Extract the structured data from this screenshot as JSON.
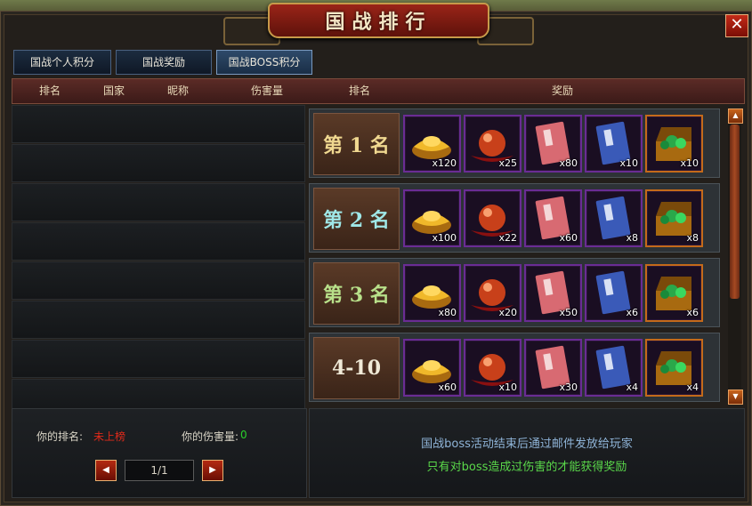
{
  "window": {
    "title": "国战排行",
    "close_label": "✕"
  },
  "tabs": [
    {
      "label": "国战个人积分"
    },
    {
      "label": "国战奖励"
    },
    {
      "label": "国战BOSS积分"
    }
  ],
  "active_tab": 2,
  "columns": {
    "rank": "排名",
    "country": "国家",
    "nickname": "昵称",
    "damage": "伤害量",
    "reward_rank": "排名",
    "reward": "奖励"
  },
  "rewards": [
    {
      "rank": "第 1 名",
      "rank_color": "#f0d890",
      "counts": [
        "x120",
        "x25",
        "x80",
        "x10",
        "x10"
      ]
    },
    {
      "rank": "第 2 名",
      "rank_color": "#9fe8e8",
      "counts": [
        "x100",
        "x22",
        "x60",
        "x8",
        "x8"
      ]
    },
    {
      "rank": "第 3 名",
      "rank_color": "#b8e08a",
      "counts": [
        "x80",
        "x20",
        "x50",
        "x6",
        "x6"
      ]
    },
    {
      "rank": "4-10",
      "rank_color": "#f0ead8",
      "counts": [
        "x60",
        "x10",
        "x30",
        "x4",
        "x4"
      ]
    }
  ],
  "reward_items": [
    "gold-ingot-icon",
    "red-orb-icon",
    "red-book-icon",
    "blue-book-icon",
    "treasure-chest-icon"
  ],
  "my_rank": {
    "label": "你的排名:",
    "value": "未上榜",
    "value_color": "#e02a1a"
  },
  "my_damage": {
    "label": "你的伤害量:",
    "value": "0",
    "value_color": "#2ad02a"
  },
  "pagination": {
    "text": "1/1",
    "prev_icon": "◀",
    "next_icon": "▶"
  },
  "info": {
    "line1": "国战boss活动结束后通过邮件发放给玩家",
    "line1_color": "#8fb4d8",
    "line2": "只有对boss造成过伤害的才能获得奖励",
    "line2_color": "#5ad84a"
  }
}
